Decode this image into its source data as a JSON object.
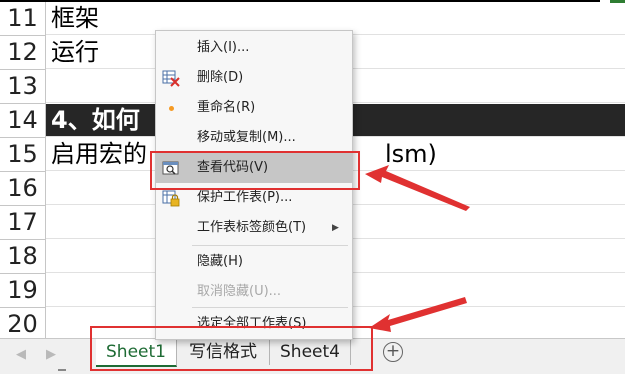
{
  "rows": [
    {
      "num": "11",
      "text": "框架",
      "tail": "",
      "dark": false
    },
    {
      "num": "12",
      "text": "运行",
      "tail": "",
      "dark": false
    },
    {
      "num": "13",
      "text": "",
      "tail": "",
      "dark": false
    },
    {
      "num": "14",
      "text": "4、如何",
      "tail": "",
      "dark": true
    },
    {
      "num": "15",
      "text": "启用宏的",
      "tail": "lsm)",
      "dark": false
    },
    {
      "num": "16",
      "text": "",
      "tail": "",
      "dark": false
    },
    {
      "num": "17",
      "text": "",
      "tail": "",
      "dark": false
    },
    {
      "num": "18",
      "text": "",
      "tail": "",
      "dark": false
    },
    {
      "num": "19",
      "text": "",
      "tail": "",
      "dark": false
    },
    {
      "num": "20",
      "text": "",
      "tail": "",
      "dark": false
    }
  ],
  "context_menu": {
    "items": [
      {
        "label": "插入(I)...",
        "icon": "",
        "disabled": false,
        "highlighted": false,
        "submenu": false
      },
      {
        "label": "删除(D)",
        "icon": "delete-sheet-icon",
        "disabled": false,
        "highlighted": false,
        "submenu": false
      },
      {
        "label": "重命名(R)",
        "icon": "rename-dot-icon",
        "disabled": false,
        "highlighted": false,
        "submenu": false
      },
      {
        "label": "移动或复制(M)...",
        "icon": "",
        "disabled": false,
        "highlighted": false,
        "submenu": false
      },
      {
        "label": "查看代码(V)",
        "icon": "view-code-icon",
        "disabled": false,
        "highlighted": true,
        "submenu": false
      },
      {
        "label": "保护工作表(P)...",
        "icon": "protect-sheet-icon",
        "disabled": false,
        "highlighted": false,
        "submenu": false
      },
      {
        "label": "工作表标签颜色(T)",
        "icon": "",
        "disabled": false,
        "highlighted": false,
        "submenu": true
      },
      {
        "label": "隐藏(H)",
        "icon": "",
        "disabled": false,
        "highlighted": false,
        "submenu": false
      },
      {
        "label": "取消隐藏(U)...",
        "icon": "",
        "disabled": true,
        "highlighted": false,
        "submenu": false
      },
      {
        "label": "选定全部工作表(S)",
        "icon": "",
        "disabled": false,
        "highlighted": false,
        "submenu": false
      }
    ]
  },
  "sheet_tabs": [
    {
      "label": "Sheet1",
      "active": true
    },
    {
      "label": "写信格式",
      "active": false
    },
    {
      "label": "Sheet4",
      "active": false
    }
  ],
  "add_sheet_symbol": "+",
  "nav_arrows": {
    "prev": "◀",
    "next": "▶"
  },
  "colors": {
    "annotation_red": "#e03131",
    "active_tab_green": "#1e6b34",
    "menu_highlight": "#c6c6c6",
    "dark_row": "#262626"
  }
}
